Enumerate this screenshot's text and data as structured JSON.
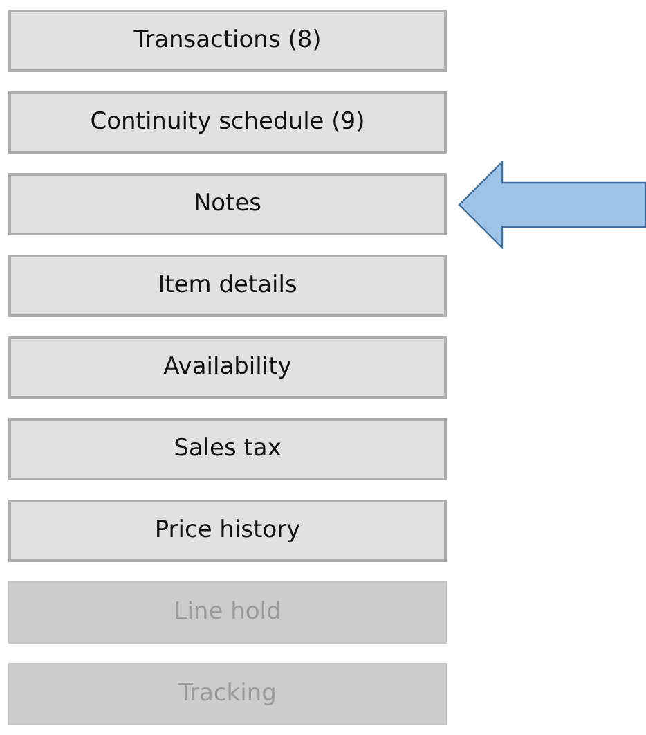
{
  "buttons": [
    {
      "label": "Transactions (8)",
      "disabled": false,
      "arrow": false
    },
    {
      "label": "Continuity schedule (9)",
      "disabled": false,
      "arrow": false
    },
    {
      "label": "Notes",
      "disabled": false,
      "arrow": true
    },
    {
      "label": "Item details",
      "disabled": false,
      "arrow": false
    },
    {
      "label": "Availability",
      "disabled": false,
      "arrow": false
    },
    {
      "label": "Sales tax",
      "disabled": false,
      "arrow": false
    },
    {
      "label": "Price history",
      "disabled": false,
      "arrow": false
    },
    {
      "label": "Line hold",
      "disabled": true,
      "arrow": false
    },
    {
      "label": "Tracking",
      "disabled": true,
      "arrow": false
    }
  ]
}
